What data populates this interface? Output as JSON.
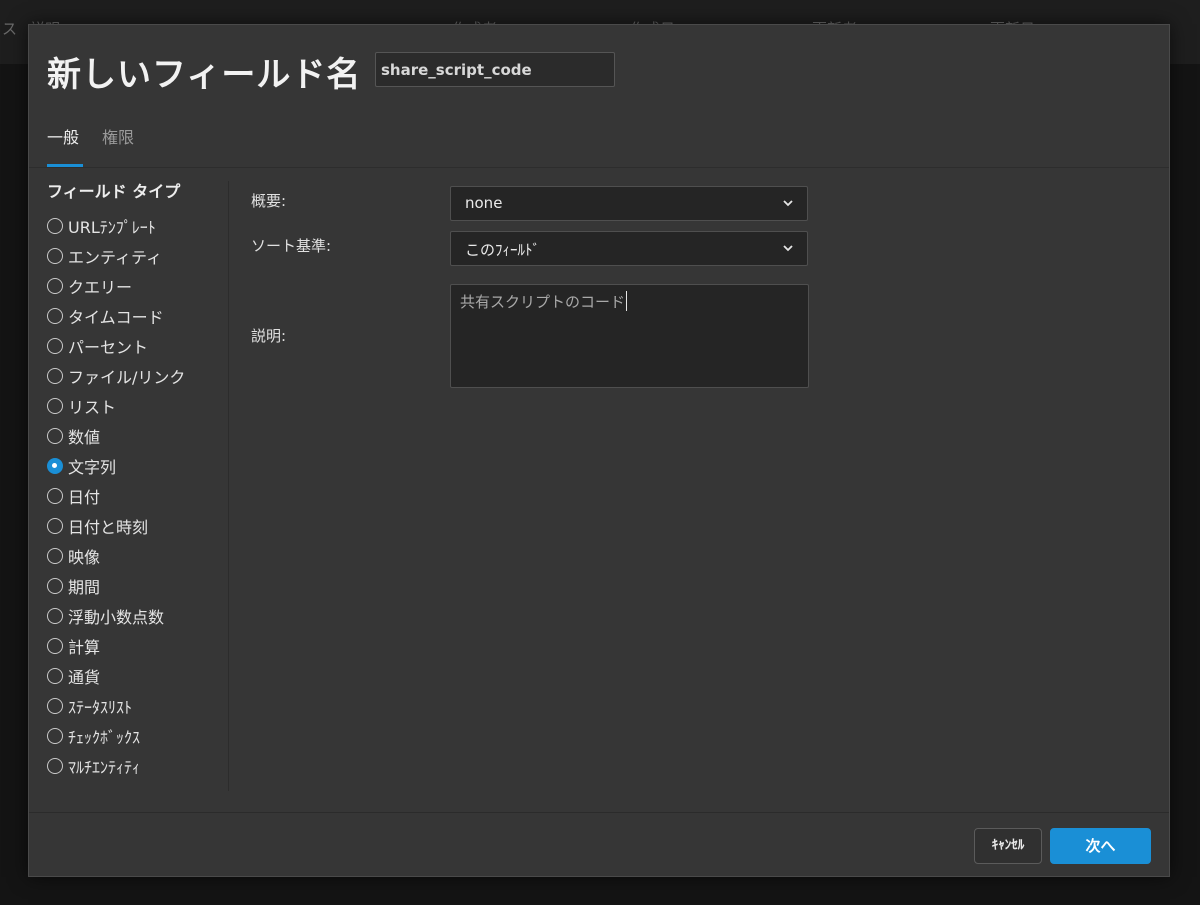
{
  "background": {
    "items": [
      "ス",
      "説明",
      "作成者",
      "作成日",
      "更新者",
      "更新日"
    ]
  },
  "dialog": {
    "title": "新しいフィールド名",
    "name_input": {
      "value": "share_script_code",
      "placeholder": ""
    },
    "tabs": [
      {
        "label": "一般",
        "active": true
      },
      {
        "label": "権限",
        "active": false
      }
    ],
    "sidebar": {
      "title": "フィールド タイプ",
      "options": [
        {
          "label": "URLﾃﾝﾌﾟﾚｰﾄ",
          "checked": false
        },
        {
          "label": "エンティティ",
          "checked": false
        },
        {
          "label": "クエリー",
          "checked": false
        },
        {
          "label": "タイムコード",
          "checked": false
        },
        {
          "label": "パーセント",
          "checked": false
        },
        {
          "label": "ファイル/リンク",
          "checked": false
        },
        {
          "label": "リスト",
          "checked": false
        },
        {
          "label": "数値",
          "checked": false
        },
        {
          "label": "文字列",
          "checked": true
        },
        {
          "label": "日付",
          "checked": false
        },
        {
          "label": "日付と時刻",
          "checked": false
        },
        {
          "label": "映像",
          "checked": false
        },
        {
          "label": "期間",
          "checked": false
        },
        {
          "label": "浮動小数点数",
          "checked": false
        },
        {
          "label": "計算",
          "checked": false
        },
        {
          "label": "通貨",
          "checked": false
        },
        {
          "label": "ｽﾃｰﾀｽﾘｽﾄ",
          "checked": false
        },
        {
          "label": "ﾁｪｯｸﾎﾞｯｸｽ",
          "checked": false
        },
        {
          "label": "ﾏﾙﾁｴﾝﾃｨﾃｨ",
          "checked": false
        }
      ]
    },
    "form": {
      "summary_label": "概要:",
      "summary_value": "none",
      "sort_label": "ソート基準:",
      "sort_value": "このﾌｨｰﾙﾄﾞ",
      "description_label": "説明:",
      "description_value": "共有スクリプトのコード"
    },
    "buttons": {
      "cancel": "ｷｬﾝｾﾙ",
      "next": "次へ"
    }
  },
  "colors": {
    "accent": "#1a8fd6",
    "dialog_bg": "#363636",
    "input_bg": "#252525"
  }
}
